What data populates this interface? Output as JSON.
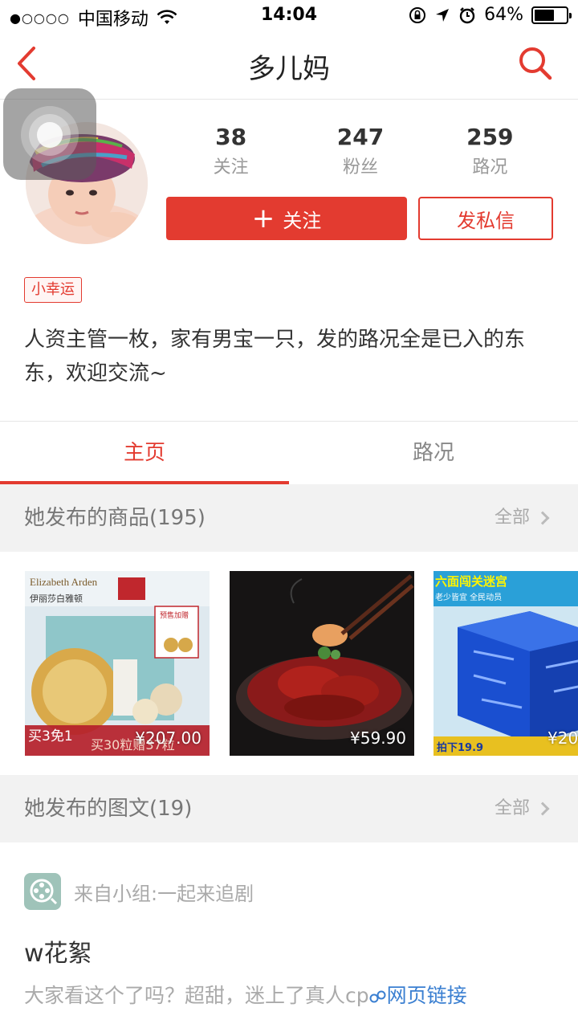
{
  "status": {
    "carrier": "中国移动",
    "time": "14:04",
    "battery": "64%",
    "battery_level": 0.64
  },
  "nav": {
    "title": "多儿妈"
  },
  "profile": {
    "stats": [
      {
        "num": "38",
        "label": "关注"
      },
      {
        "num": "247",
        "label": "粉丝"
      },
      {
        "num": "259",
        "label": "路况"
      }
    ],
    "follow_label": "关注",
    "message_label": "发私信",
    "tag": "小幸运",
    "bio": "人资主管一枚，家有男宝一只，发的路况全是已入的东东，欢迎交流~"
  },
  "tabs": [
    {
      "label": "主页",
      "active": true
    },
    {
      "label": "路况",
      "active": false
    }
  ],
  "products_section": {
    "title": "她发布的商品(195)",
    "more": "全部"
  },
  "products": [
    {
      "price": "¥207.00",
      "brand": "Elizabeth Arden",
      "brand_cn": "伊丽莎白雅顿",
      "badge": "预售加赠",
      "promo": "买3免1",
      "promo2": "买30粒赠37粒"
    },
    {
      "price": "¥59.90"
    },
    {
      "price": "¥20",
      "banner": "六面闯关迷宫",
      "banner2": "老少皆宜 全民动员",
      "promo": "拍下19.9"
    }
  ],
  "posts_section": {
    "title": "她发布的图文(19)",
    "more": "全部"
  },
  "post": {
    "group": "来自小组:一起来追剧",
    "title": "w花絮",
    "text": "大家看这个了吗？超甜，迷上了真人cp",
    "link": "网页链接"
  }
}
